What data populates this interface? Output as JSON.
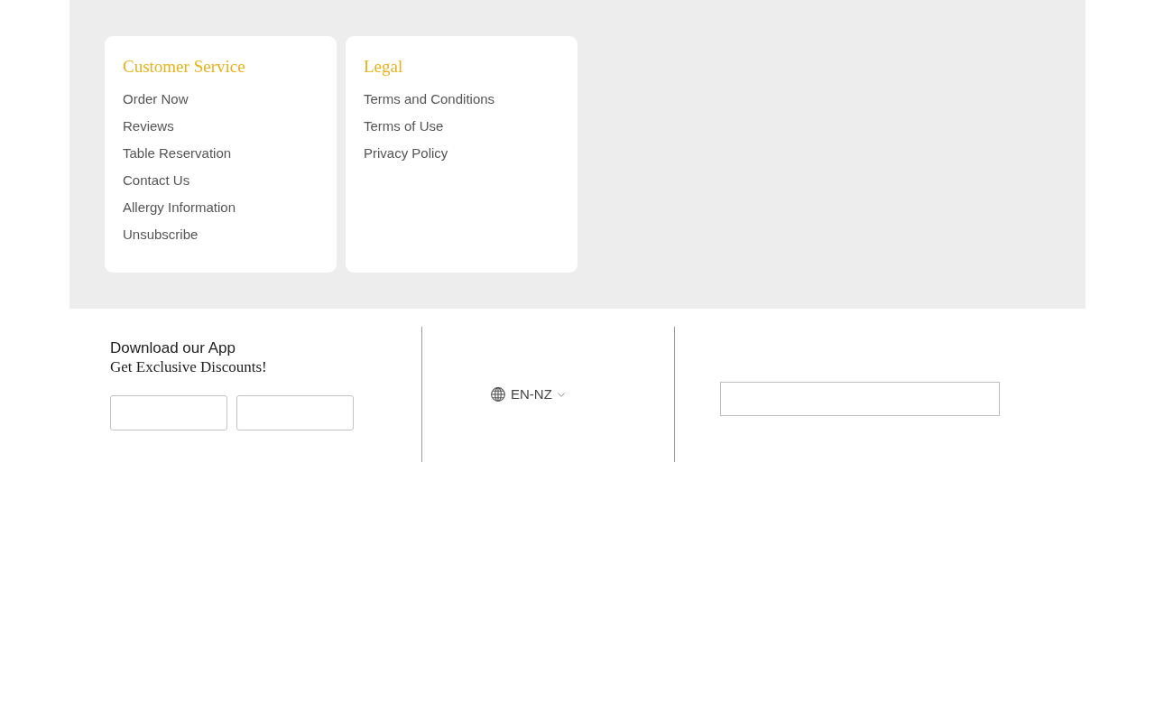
{
  "link_cards": [
    {
      "title": "Customer Service",
      "links": [
        "Order Now",
        "Reviews",
        "Table Reservation",
        "Contact Us",
        "Allergy Information",
        "Unsubscribe"
      ]
    },
    {
      "title": "Legal",
      "links": [
        "Terms and Conditions",
        "Terms of Use",
        "Privacy Policy"
      ]
    }
  ],
  "app_promo": {
    "title": "Download our App",
    "subtitle": "Get Exclusive Discounts!"
  },
  "language": {
    "label": "EN-NZ"
  }
}
